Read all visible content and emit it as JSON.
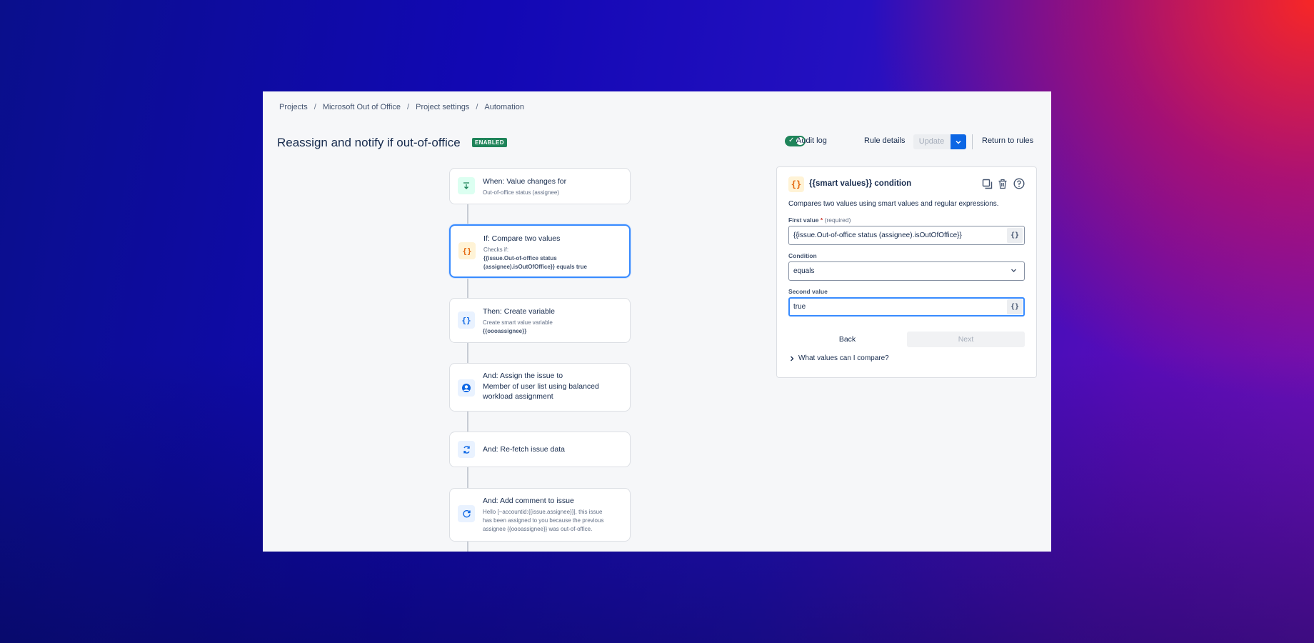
{
  "breadcrumb": [
    "Projects",
    "Microsoft Out of Office",
    "Project settings",
    "Automation"
  ],
  "header": {
    "title": "Reassign and notify if out-of-office",
    "status_badge": "ENABLED",
    "audit_log": "Audit log",
    "rule_details": "Rule details",
    "update": "Update",
    "return_to_rules": "Return to rules",
    "toggle_enabled": true
  },
  "flow": {
    "steps": [
      {
        "title": "When: Value changes for",
        "sub": "Out-of-office status (assignee)",
        "icon": "trigger-icon"
      },
      {
        "title": "If: Compare two values",
        "sub1": "Checks if:",
        "sub2": "{{issue.Out-of-office status",
        "sub3": "(assignee).isOutOfOffice}} equals true",
        "icon": "smart-value-icon"
      },
      {
        "title": "Then: Create variable",
        "sub1": "Create smart value variable",
        "sub2": "{{oooassignee}}",
        "icon": "variable-icon"
      },
      {
        "title1": "And: Assign the issue to",
        "title2": "Member of user list using balanced",
        "title3": "workload assignment",
        "icon": "assign-user-icon"
      },
      {
        "title": "And: Re-fetch issue data",
        "icon": "refresh-icon"
      },
      {
        "title": "And: Add comment to issue",
        "sub1": "Hello [~accountid:{{issue.assignee}}], this issue",
        "sub2": "has been assigned to you because the previous",
        "sub3": "assignee {{oooassignee}} was out-of-office.",
        "icon": "comment-icon"
      }
    ]
  },
  "panel": {
    "title": "{{smart values}} condition",
    "description": "Compares two values using smart values and regular expressions.",
    "first_value_label": "First value",
    "required_marker": "*",
    "required_text": "(required)",
    "first_value": "{{issue.Out-of-office status (assignee).isOutOfOffice}}",
    "condition_label": "Condition",
    "condition_value": "equals",
    "second_value_label": "Second value",
    "second_value": "true",
    "smart_value_button": "{}",
    "back": "Back",
    "next": "Next",
    "help_expander": "What values can I compare?"
  },
  "colors": {
    "accent": "#0c66e4",
    "enabled_green": "#1f845a",
    "selected_border": "#388bff"
  }
}
